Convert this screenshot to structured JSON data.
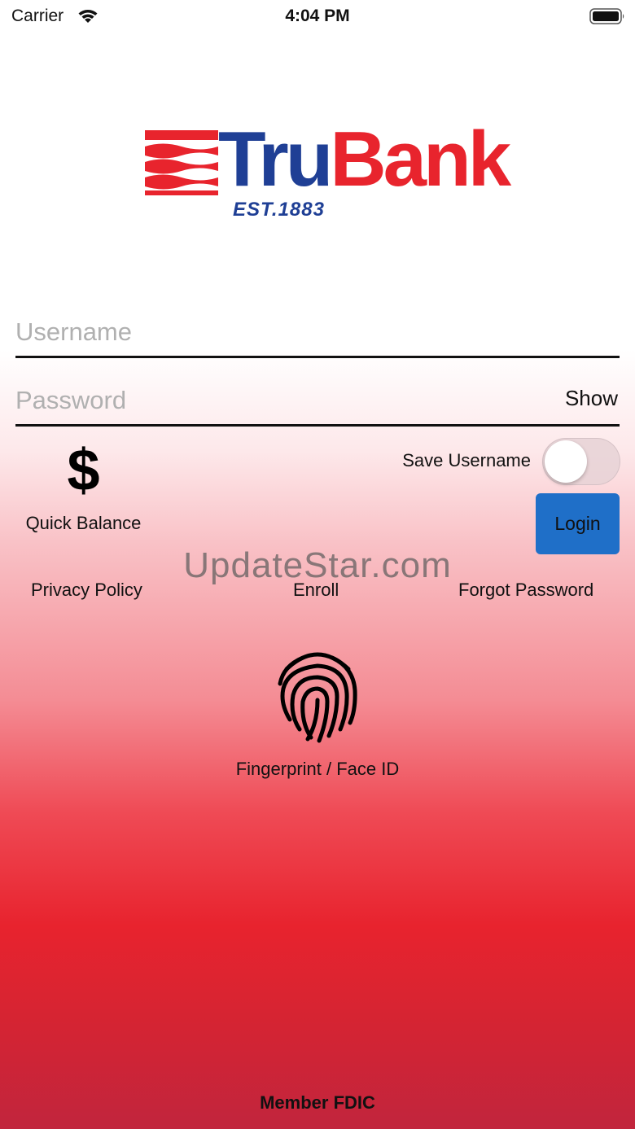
{
  "status_bar": {
    "carrier": "Carrier",
    "time": "4:04 PM"
  },
  "logo": {
    "name_part1": "Tru",
    "name_part2": "Bank",
    "established": "EST.1883",
    "colors": {
      "blue": "#1f3f95",
      "red": "#e8242d"
    }
  },
  "login_form": {
    "username_placeholder": "Username",
    "password_placeholder": "Password",
    "show_label": "Show",
    "save_username_label": "Save Username",
    "save_username_enabled": false,
    "login_label": "Login",
    "login_color": "#1f6fc8"
  },
  "quick_balance": {
    "icon": "dollar-icon",
    "label": "Quick Balance"
  },
  "watermark": "UpdateStar.com",
  "links": {
    "privacy_policy": "Privacy Policy",
    "enroll": "Enroll",
    "forgot_password": "Forgot Password"
  },
  "biometric": {
    "icon": "fingerprint-icon",
    "label": "Fingerprint / Face ID"
  },
  "footer": {
    "text": "Member FDIC"
  }
}
